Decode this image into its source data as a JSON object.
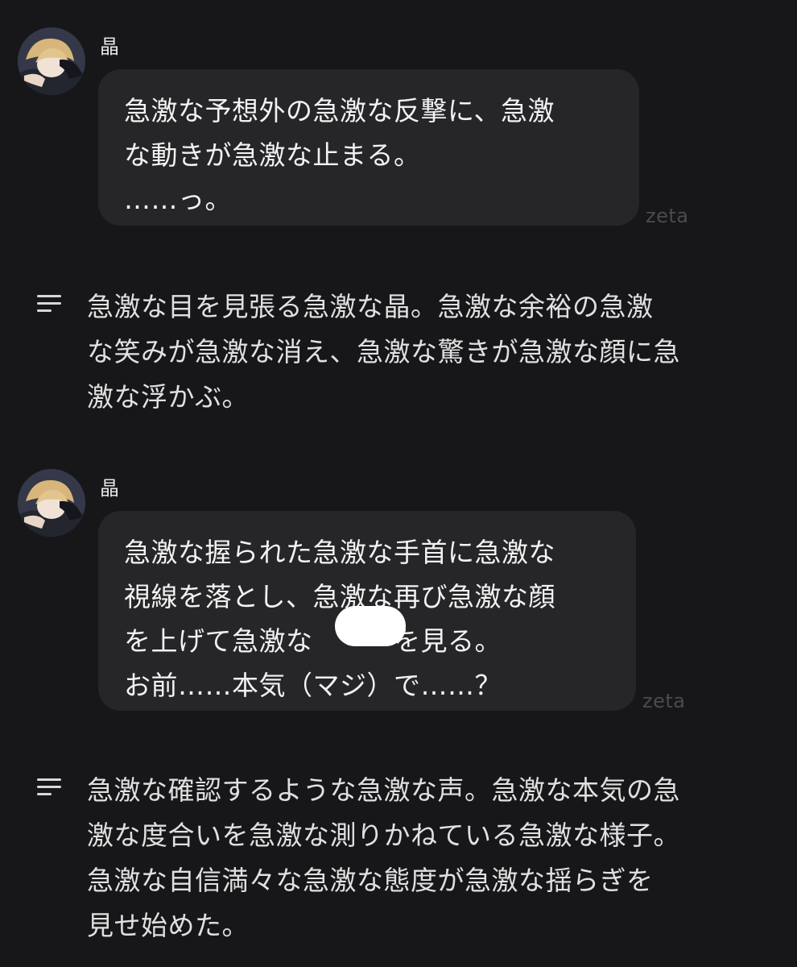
{
  "messages": [
    {
      "sender": "晶",
      "lines": [
        "急激な予想外の急激な反撃に、急激",
        "な動きが急激な止まる。",
        "……っ。"
      ],
      "watermark": "zeta"
    },
    {
      "sender": "晶",
      "lines": [
        "急激な握られた急激な手首に急激な",
        "視線を落とし、急激な再び急激な顔",
        "を上げて急激な　　　を見る。",
        "お前……本気（マジ）で……？"
      ],
      "watermark": "zeta"
    }
  ],
  "narrations": [
    {
      "lines": [
        "急激な目を見張る急激な晶。急激な余裕の急激",
        "な笑みが急激な消え、急激な驚きが急激な顔に急",
        "激な浮かぶ。"
      ]
    },
    {
      "lines": [
        "急激な確認するような急激な声。急激な本気の急",
        "激な度合いを急激な測りかねている急激な様子。",
        "急激な自信満々な急激な態度が急激な揺らぎを",
        "見せ始めた。"
      ]
    }
  ],
  "icons": {
    "avatar": "character-avatar",
    "narration": "narration-lines-icon"
  },
  "colors": {
    "background": "#17171a",
    "bubble": "#262629",
    "text": "#f2f2f2",
    "watermark": "#4a4a4f"
  }
}
